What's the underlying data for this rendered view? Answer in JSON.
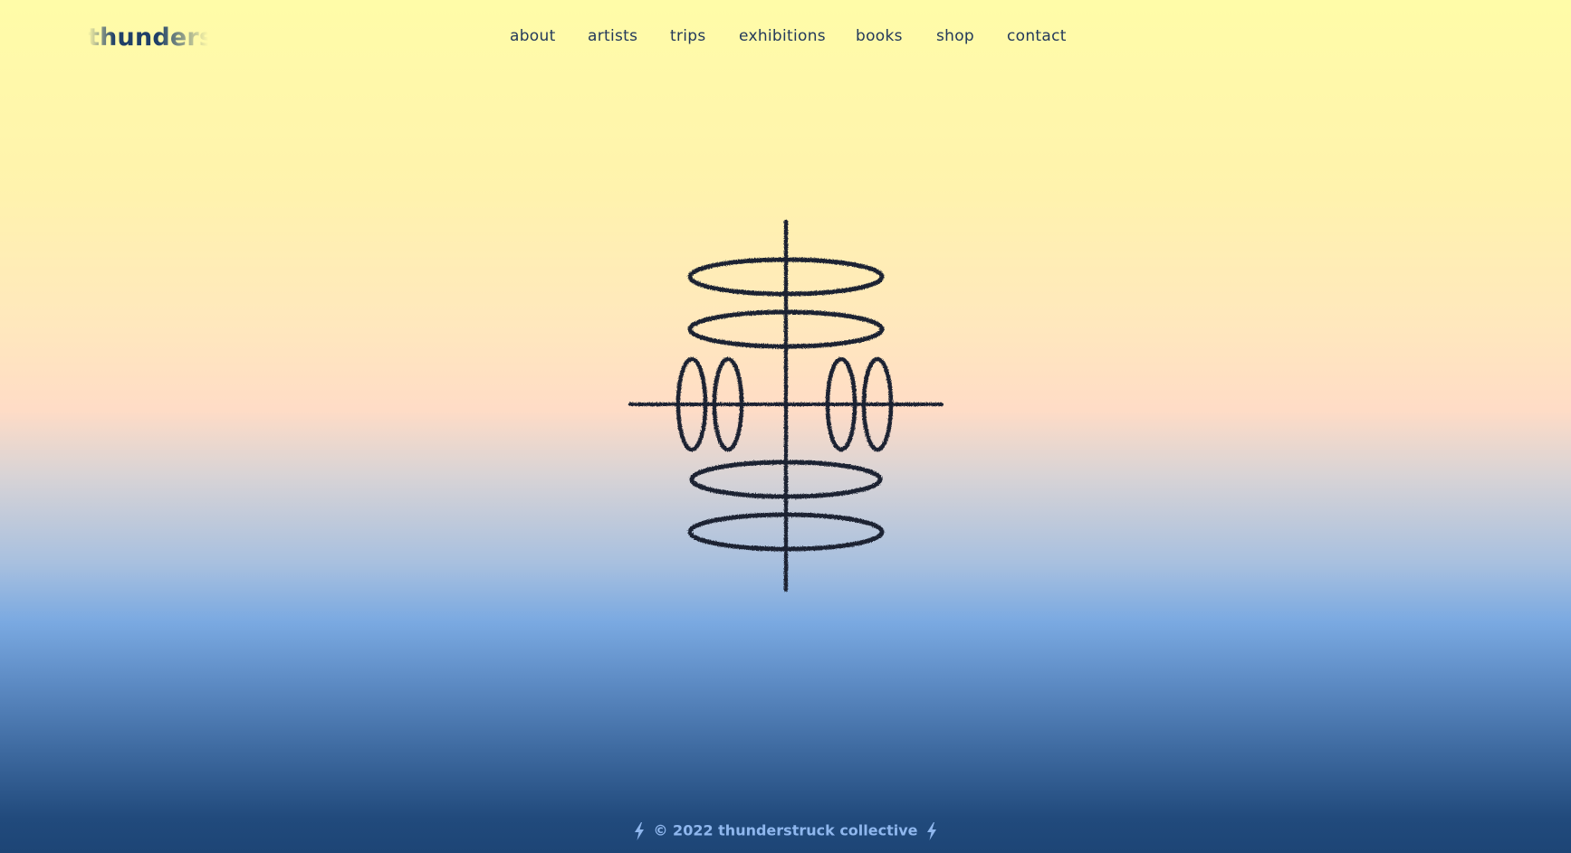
{
  "header": {
    "logo_text": "thunderstruck"
  },
  "nav": {
    "items": [
      {
        "label": "about"
      },
      {
        "label": "artists"
      },
      {
        "label": "trips"
      },
      {
        "label": "exhibitions"
      },
      {
        "label": "books"
      },
      {
        "label": "shop"
      },
      {
        "label": "contact"
      }
    ]
  },
  "hero": {
    "emblem_icon": "ring-axis-drawing-icon"
  },
  "footer": {
    "text": "© 2022 thunderstruck collective",
    "bolt_icon": "lightning-bolt-icon"
  },
  "colors": {
    "nav_text": "#23395b",
    "footer_text": "#8fb7ee",
    "drawing_ink": "#1a2333",
    "gradient_top": "#fffca8",
    "gradient_bottom": "#1d4576"
  }
}
